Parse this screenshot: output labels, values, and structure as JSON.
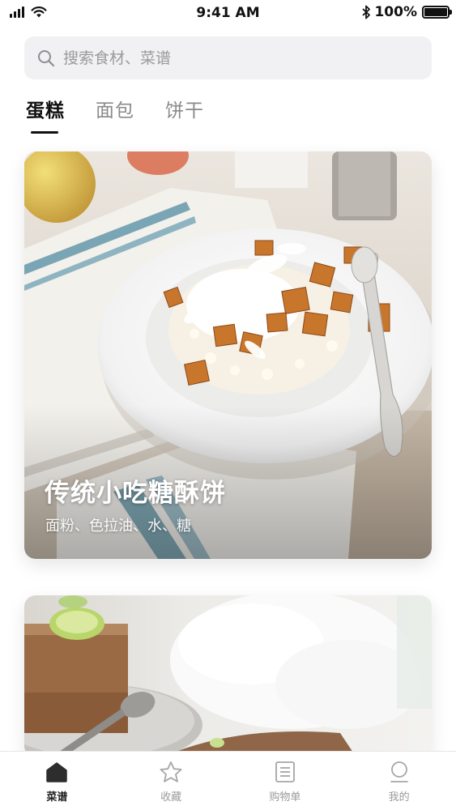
{
  "status_bar": {
    "time": "9:41 AM",
    "battery": "100%",
    "icons": [
      "signal-icon",
      "wifi-icon",
      "bluetooth-icon",
      "battery-icon"
    ]
  },
  "search": {
    "placeholder": "搜索食材、菜谱",
    "value": "",
    "icon": "search-icon"
  },
  "tabs": [
    {
      "label": "蛋糕",
      "active": true
    },
    {
      "label": "面包",
      "active": false
    },
    {
      "label": "饼干",
      "active": false
    }
  ],
  "cards": [
    {
      "title": "传统小吃糖酥饼",
      "subtitle": "面粉、色拉油、水、糖"
    }
  ],
  "bottom_nav": [
    {
      "label": "菜谱",
      "icon": "home-icon",
      "active": true
    },
    {
      "label": "收藏",
      "icon": "star-icon",
      "active": false
    },
    {
      "label": "购物单",
      "icon": "list-icon",
      "active": false
    },
    {
      "label": "我的",
      "icon": "profile-icon",
      "active": false
    }
  ],
  "colors": {
    "text_primary": "#111111",
    "text_secondary": "#8a8a8a",
    "search_bg": "#f1f1f3",
    "nav_inactive": "#9a9a9a"
  }
}
